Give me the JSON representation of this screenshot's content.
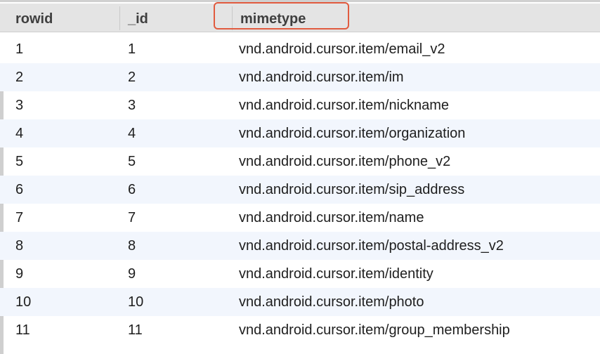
{
  "table": {
    "columns": [
      "rowid",
      "_id",
      "mimetype"
    ],
    "rows": [
      {
        "rowid": "1",
        "id": "1",
        "mimetype": "vnd.android.cursor.item/email_v2"
      },
      {
        "rowid": "2",
        "id": "2",
        "mimetype": "vnd.android.cursor.item/im"
      },
      {
        "rowid": "3",
        "id": "3",
        "mimetype": "vnd.android.cursor.item/nickname"
      },
      {
        "rowid": "4",
        "id": "4",
        "mimetype": "vnd.android.cursor.item/organization"
      },
      {
        "rowid": "5",
        "id": "5",
        "mimetype": "vnd.android.cursor.item/phone_v2"
      },
      {
        "rowid": "6",
        "id": "6",
        "mimetype": "vnd.android.cursor.item/sip_address"
      },
      {
        "rowid": "7",
        "id": "7",
        "mimetype": "vnd.android.cursor.item/name"
      },
      {
        "rowid": "8",
        "id": "8",
        "mimetype": "vnd.android.cursor.item/postal-address_v2"
      },
      {
        "rowid": "9",
        "id": "9",
        "mimetype": "vnd.android.cursor.item/identity"
      },
      {
        "rowid": "10",
        "id": "10",
        "mimetype": "vnd.android.cursor.item/photo"
      },
      {
        "rowid": "11",
        "id": "11",
        "mimetype": "vnd.android.cursor.item/group_membership"
      }
    ]
  },
  "colors": {
    "header_bg": "#e4e4e4",
    "alt_row_bg": "#f2f6fd",
    "highlight_border": "#e15b3f"
  }
}
